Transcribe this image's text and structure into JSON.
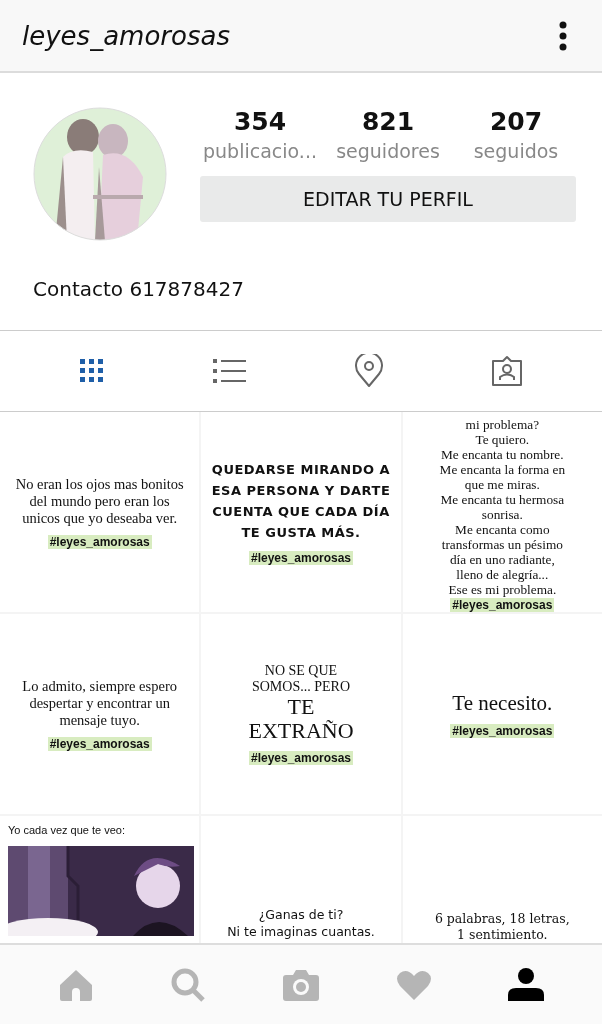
{
  "header": {
    "title": "leyes_amorosas"
  },
  "profile": {
    "stats": [
      {
        "value": "354",
        "label": "publicacio..."
      },
      {
        "value": "821",
        "label": "seguidores"
      },
      {
        "value": "207",
        "label": "seguidos"
      }
    ],
    "edit_button": "EDITAR TU PERFIL",
    "bio": "Contacto 617878427"
  },
  "tabs": [
    {
      "selected": true
    },
    {
      "selected": false
    },
    {
      "selected": false
    },
    {
      "selected": false
    }
  ],
  "posts": [
    {
      "kind": "text",
      "lines": [
        "No eran los ojos mas bonitos",
        "del mundo pero eran los",
        "unicos que yo deseaba ver."
      ],
      "hashtag": "#leyes_amorosas"
    },
    {
      "kind": "text",
      "lines": [
        "QUEDARSE MIRANDO A",
        "ESA PERSONA Y DARTE",
        "CUENTA QUE CADA DÍA",
        "TE GUSTA MÁS."
      ],
      "hashtag": "#leyes_amorosas"
    },
    {
      "kind": "text",
      "lines": [
        "mi problema?",
        "Te quiero.",
        "Me encanta tu nombre.",
        "Me encanta la forma en",
        "que me miras.",
        "Me encanta tu hermosa",
        "sonrisa.",
        "Me encanta como",
        "transformas un pésimo",
        "día en uno radiante,",
        "lleno de alegría...",
        "Ese es mi problema."
      ],
      "hashtag": "#leyes_amorosas"
    },
    {
      "kind": "text",
      "lines": [
        "Lo admito, siempre espero",
        "despertar y encontrar un",
        "mensaje tuyo."
      ],
      "hashtag": "#leyes_amorosas"
    },
    {
      "kind": "text",
      "lines": [
        "NO SE QUE",
        "SOMOS... PERO",
        "TE",
        "EXTRAÑO"
      ],
      "hashtag": "#leyes_amorosas"
    },
    {
      "kind": "text",
      "lines": [
        "Te necesito."
      ],
      "hashtag": "#leyes_amorosas"
    },
    {
      "kind": "meme",
      "caption": "Yo cada vez que te veo:"
    },
    {
      "kind": "text",
      "lines": [
        "¿Ganas de ti?",
        "Ni te imaginas cuantas."
      ]
    },
    {
      "kind": "text",
      "lines": [
        "6 palabras, 18 letras,",
        "1 sentimiento."
      ]
    }
  ],
  "bottom_nav": [
    {
      "selected": false
    },
    {
      "selected": false
    },
    {
      "selected": false
    },
    {
      "selected": false
    },
    {
      "selected": true
    }
  ]
}
